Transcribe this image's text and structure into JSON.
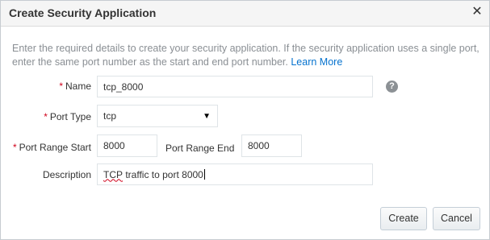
{
  "dialog": {
    "title": "Create Security Application",
    "close_glyph": "✕"
  },
  "intro": {
    "text": "Enter the required details to create your security application. If the security application uses a single port, enter the same port number as the start and end port number. ",
    "link": "Learn More"
  },
  "form": {
    "required_marker": "*",
    "name": {
      "label": "Name",
      "value": "tcp_8000",
      "help_glyph": "?"
    },
    "port_type": {
      "label": "Port Type",
      "value": "tcp",
      "arrow": "▼"
    },
    "port_range_start": {
      "label": "Port Range Start",
      "value": "8000"
    },
    "port_range_end": {
      "label": "Port Range End",
      "value": "8000"
    },
    "description": {
      "label": "Description",
      "value_word1": "TCP",
      "value_rest": " traffic to port 8000"
    }
  },
  "buttons": {
    "create": "Create",
    "cancel": "Cancel"
  },
  "colors": {
    "accent_link": "#0572ce",
    "required": "#d0021b"
  }
}
